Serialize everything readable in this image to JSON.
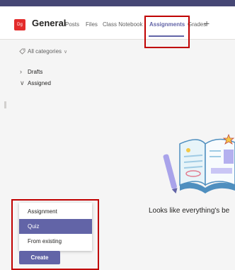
{
  "header": {
    "team_badge": "Dg",
    "channel_title": "General",
    "tabs": [
      {
        "label": "Posts"
      },
      {
        "label": "Files"
      },
      {
        "label": "Class Notebook"
      },
      {
        "label": "Assignments",
        "active": true
      },
      {
        "label": "Grades"
      }
    ],
    "add_tab": "+"
  },
  "filter": {
    "label": "All categories"
  },
  "sections": [
    {
      "label": "Drafts",
      "expanded": false
    },
    {
      "label": "Assigned",
      "expanded": true
    }
  ],
  "empty_state": {
    "message": "Looks like everything's be"
  },
  "create_menu": {
    "items": [
      {
        "label": "Assignment"
      },
      {
        "label": "Quiz",
        "selected": true
      },
      {
        "label": "From existing"
      }
    ],
    "create_label": "Create"
  },
  "colors": {
    "accent": "#6264a7",
    "topbar": "#464775",
    "highlight": "#c00000",
    "badge": "#e32b2b"
  },
  "icons": {
    "filter": "tag-icon",
    "add_tab": "plus-icon"
  }
}
